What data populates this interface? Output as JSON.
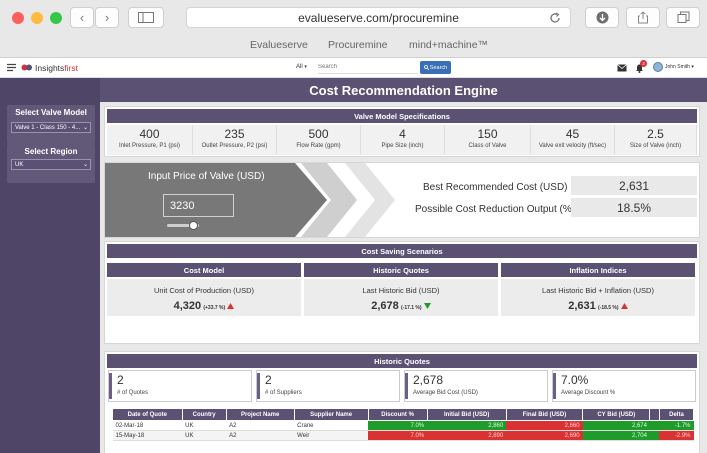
{
  "browser": {
    "url": "evalueserve.com/procuremine",
    "tabs": [
      "Evalueserve",
      "Procuremine",
      "mind+machine™"
    ]
  },
  "app": {
    "brand_prefix": "Insights",
    "brand_suffix": "first",
    "search_scope": "All",
    "search_placeholder": "Search",
    "search_button": "Search",
    "notification_count": "3",
    "user_name": "John Smith"
  },
  "sidebar": {
    "valve_model_label": "Select Valve Model",
    "valve_model_value": "Valve 1 - Class 150 - 4...",
    "region_label": "Select Region",
    "region_value": "UK"
  },
  "page_title": "Cost Recommendation Engine",
  "specs": {
    "title": "Valve Model Specifications",
    "items": [
      {
        "value": "400",
        "label": "Inlet Pressure, P1 (psi)"
      },
      {
        "value": "235",
        "label": "Outlet Pressure, P2 (psi)"
      },
      {
        "value": "500",
        "label": "Flow Rate (gpm)"
      },
      {
        "value": "4",
        "label": "Pipe Size (inch)"
      },
      {
        "value": "150",
        "label": "Class of Valve"
      },
      {
        "value": "45",
        "label": "Valve exit velocity (ft/sec)"
      },
      {
        "value": "2.5",
        "label": "Size of Valve (inch)"
      }
    ]
  },
  "price_input": {
    "label": "Input Price of Valve (USD)",
    "value": "3230",
    "slider_level": 0.2
  },
  "recommendation": {
    "best_cost_label": "Best Recommended Cost (USD)",
    "best_cost_value": "2,631",
    "reduction_label": "Possible Cost Reduction Output (%)",
    "reduction_value": "18.5%"
  },
  "scenarios": {
    "title": "Cost Saving Scenarios",
    "cards": [
      {
        "header": "Cost Model",
        "label": "Unit Cost of Production (USD)",
        "value": "4,320",
        "delta": "(+33.7 %)",
        "trend": "up"
      },
      {
        "header": "Historic Quotes",
        "label": "Last Historic Bid (USD)",
        "value": "2,678",
        "delta": "(-17.1 %)",
        "trend": "down"
      },
      {
        "header": "Inflation Indices",
        "label": "Last Historic Bid + Inflation (USD)",
        "value": "2,631",
        "delta": "(-18.5 %)",
        "trend": "up"
      }
    ]
  },
  "historic": {
    "title": "Historic Quotes",
    "kpis": [
      {
        "value": "2",
        "label": "# of Quotes"
      },
      {
        "value": "2",
        "label": "# of Suppliers"
      },
      {
        "value": "2,678",
        "label": "Average Bid Cost (USD)"
      },
      {
        "value": "7.0%",
        "label": "Average Discount %"
      }
    ],
    "columns": [
      "Date of Quote",
      "Country",
      "Project Name",
      "Supplier Name",
      "Discount %",
      "Initial Bid (USD)",
      "Final Bid (USD)",
      "CY Bid (USD)",
      "",
      "Delta"
    ],
    "rows": [
      {
        "date": "02-Mar-18",
        "country": "UK",
        "project": "A2",
        "supplier": "Crane",
        "discount": "7.0%",
        "initial": "2,860",
        "final": "2,660",
        "cy": "2,674",
        "delta": "-1.7%"
      },
      {
        "date": "15-May-18",
        "country": "UK",
        "project": "A2",
        "supplier": "Weir",
        "discount": "7.0%",
        "initial": "2,890",
        "final": "2,690",
        "cy": "2,704",
        "delta": "-2.9%"
      }
    ]
  },
  "colors": {
    "brand_purple": "#5a5173",
    "sidebar": "#4f4566",
    "positive": "#1f9b2b",
    "negative": "#d83232"
  }
}
